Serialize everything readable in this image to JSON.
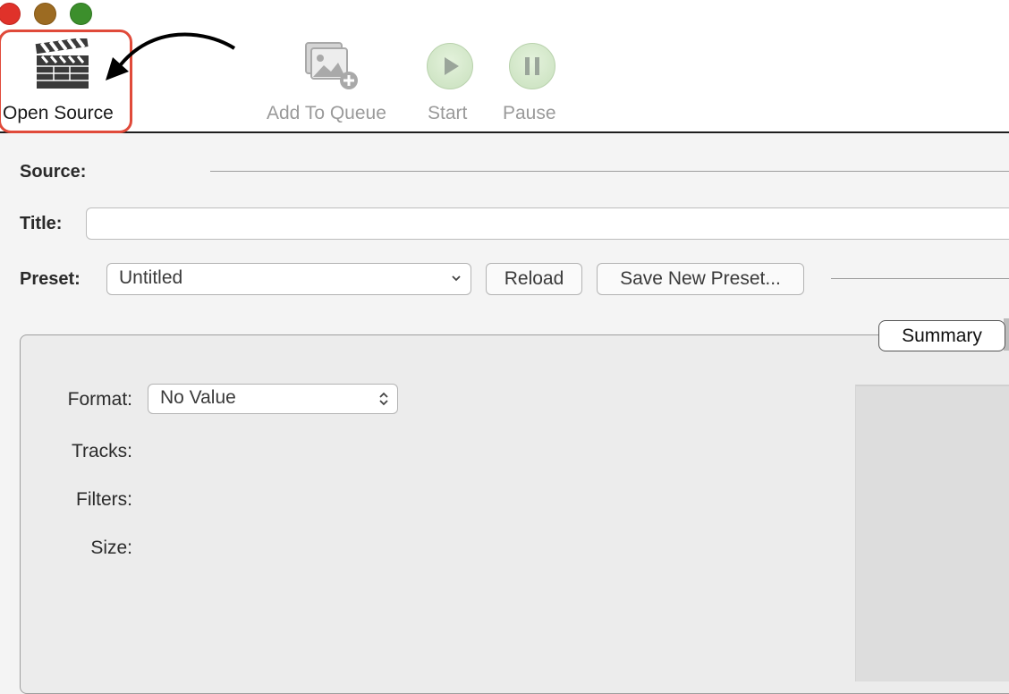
{
  "toolbar": {
    "open_source": "Open Source",
    "add_to_queue": "Add To Queue",
    "start": "Start",
    "pause": "Pause"
  },
  "form": {
    "source_label": "Source:",
    "title_label": "Title:",
    "title_value": "",
    "preset_label": "Preset:",
    "preset_value": "Untitled",
    "reload_label": "Reload",
    "save_preset_label": "Save New Preset..."
  },
  "summary": {
    "tab_label": "Summary",
    "format_label": "Format:",
    "format_value": "No Value",
    "tracks_label": "Tracks:",
    "filters_label": "Filters:",
    "size_label": "Size:"
  },
  "colors": {
    "highlight": "#e04a3a",
    "close": "#e0322a",
    "minimize": "#9c6b22",
    "maximize": "#3c8f2c"
  }
}
